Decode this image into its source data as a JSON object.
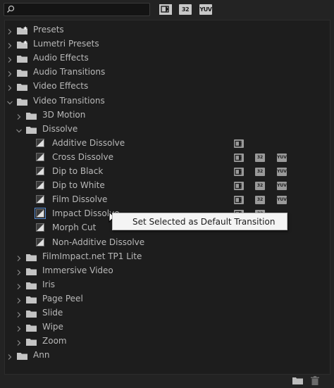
{
  "toolbar": {
    "search_value": "",
    "filters": [
      {
        "label": "",
        "icon": "accelerated-effects-icon"
      },
      {
        "label": "32",
        "icon": "32-bit-color-icon"
      },
      {
        "label": "YUV",
        "icon": "yuv-icon"
      }
    ]
  },
  "tree": [
    {
      "label": "Presets",
      "type": "folder-star",
      "level": 0,
      "expanded": false
    },
    {
      "label": "Lumetri Presets",
      "type": "folder-star",
      "level": 0,
      "expanded": false
    },
    {
      "label": "Audio Effects",
      "type": "folder",
      "level": 0,
      "expanded": false
    },
    {
      "label": "Audio Transitions",
      "type": "folder",
      "level": 0,
      "expanded": false
    },
    {
      "label": "Video Effects",
      "type": "folder",
      "level": 0,
      "expanded": false
    },
    {
      "label": "Video Transitions",
      "type": "folder",
      "level": 0,
      "expanded": true
    },
    {
      "label": "3D Motion",
      "type": "folder",
      "level": 1,
      "expanded": false
    },
    {
      "label": "Dissolve",
      "type": "folder",
      "level": 1,
      "expanded": true
    },
    {
      "label": "Additive Dissolve",
      "type": "item",
      "level": 2,
      "badges": [
        "accel"
      ]
    },
    {
      "label": "Cross Dissolve",
      "type": "item",
      "level": 2,
      "badges": [
        "accel",
        "32",
        "yuv"
      ]
    },
    {
      "label": "Dip to Black",
      "type": "item",
      "level": 2,
      "badges": [
        "accel",
        "32",
        "yuv"
      ]
    },
    {
      "label": "Dip to White",
      "type": "item",
      "level": 2,
      "badges": [
        "accel",
        "32",
        "yuv"
      ]
    },
    {
      "label": "Film Dissolve",
      "type": "item",
      "level": 2,
      "badges": [
        "accel",
        "32",
        "yuv"
      ]
    },
    {
      "label": "Impact Dissolve",
      "type": "item",
      "level": 2,
      "selected": true,
      "badges": [
        "accel",
        "32"
      ]
    },
    {
      "label": "Morph Cut",
      "type": "item",
      "level": 2,
      "badges": []
    },
    {
      "label": "Non-Additive Dissolve",
      "type": "item",
      "level": 2,
      "badges": []
    },
    {
      "label": "FilmImpact.net TP1 Lite",
      "type": "folder",
      "level": 1,
      "expanded": false
    },
    {
      "label": "Immersive Video",
      "type": "folder",
      "level": 1,
      "expanded": false
    },
    {
      "label": "Iris",
      "type": "folder",
      "level": 1,
      "expanded": false
    },
    {
      "label": "Page Peel",
      "type": "folder",
      "level": 1,
      "expanded": false
    },
    {
      "label": "Slide",
      "type": "folder",
      "level": 1,
      "expanded": false
    },
    {
      "label": "Wipe",
      "type": "folder",
      "level": 1,
      "expanded": false
    },
    {
      "label": "Zoom",
      "type": "folder",
      "level": 1,
      "expanded": false
    },
    {
      "label": "Ann",
      "type": "folder",
      "level": 0,
      "expanded": false
    }
  ],
  "context_menu": {
    "item_label": "Set Selected as Default Transition"
  },
  "footer": {
    "new_bin_icon": "new-bin-icon",
    "delete_icon": "trash-icon"
  },
  "colors": {
    "panel_bg": "#1d1d1d",
    "text": "#b9b9b9",
    "selection_outline": "#5a8fd6"
  }
}
